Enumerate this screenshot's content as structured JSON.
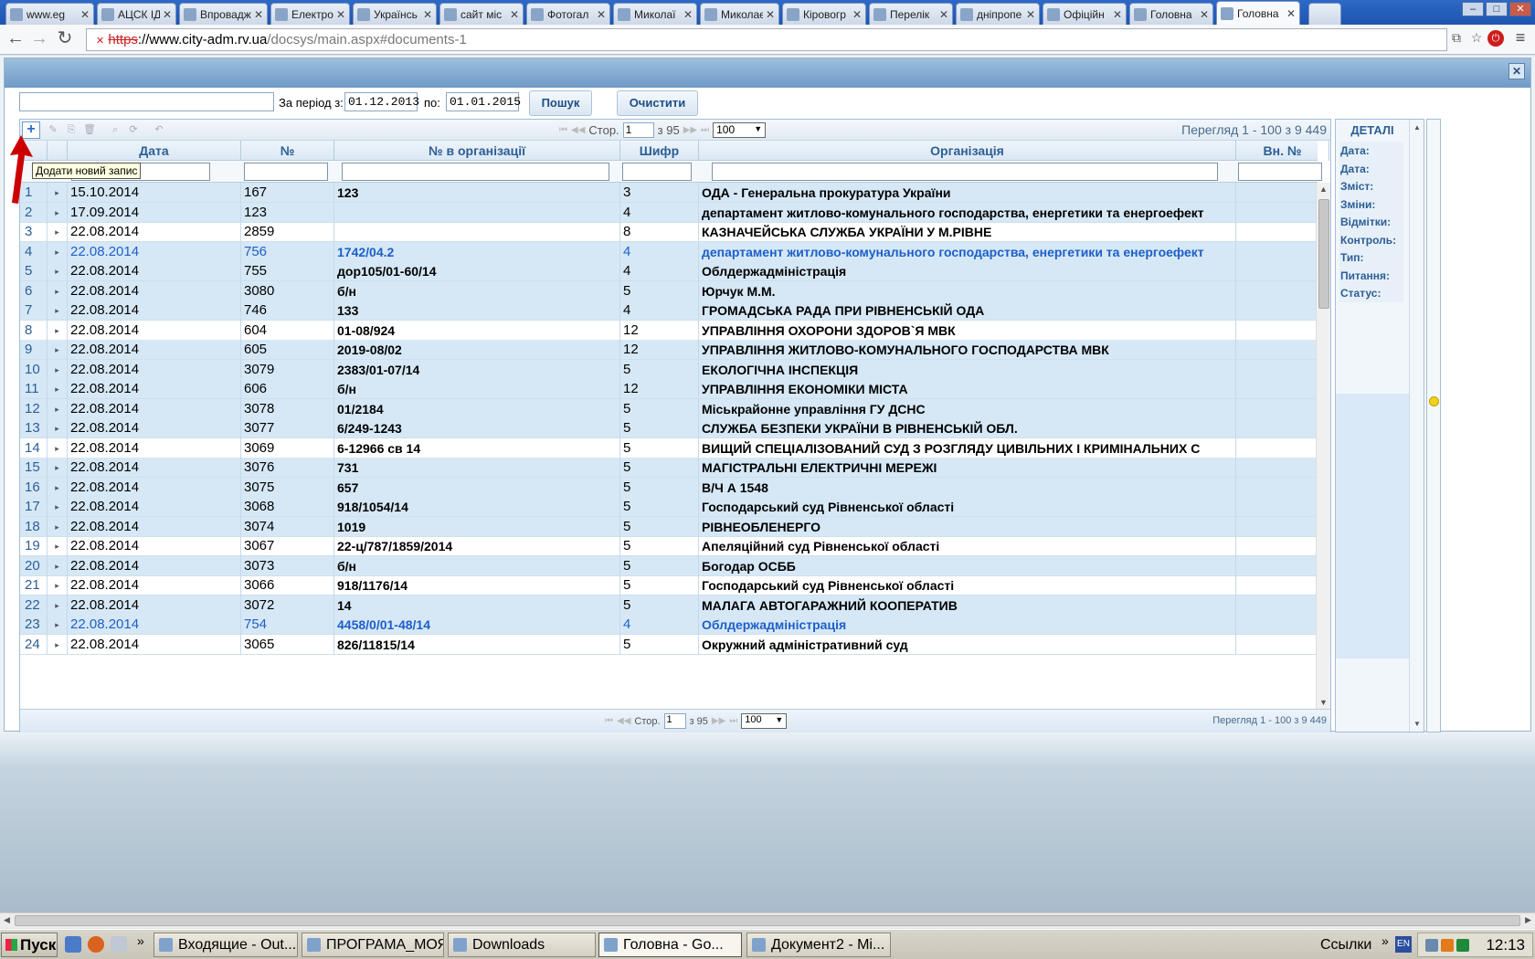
{
  "browser": {
    "tabs": [
      {
        "label": "www.eg",
        "active": false
      },
      {
        "label": "АЦСК ІД",
        "active": false
      },
      {
        "label": "Впровадж",
        "active": false
      },
      {
        "label": "Електро",
        "active": false
      },
      {
        "label": "Українсь",
        "active": false
      },
      {
        "label": "сайт міс",
        "active": false
      },
      {
        "label": "Фотогал",
        "active": false
      },
      {
        "label": "Миколаї",
        "active": false
      },
      {
        "label": "Миколає",
        "active": false
      },
      {
        "label": "Кіровогр",
        "active": false
      },
      {
        "label": "Перелік",
        "active": false
      },
      {
        "label": "дніпропе",
        "active": false
      },
      {
        "label": "Офіційн",
        "active": false
      },
      {
        "label": "Головна",
        "active": false
      },
      {
        "label": "Головна",
        "active": true
      }
    ],
    "url_scheme": "https",
    "url_host": "://www.city-adm.rv.ua",
    "url_path": "/docsys/main.aspx#documents-1"
  },
  "filters": {
    "period_label": "За період з:",
    "date_from": "01.12.2013",
    "to_label": "по:",
    "date_to": "01.01.2015",
    "search_button": "Пошук",
    "clear_button": "Очистити"
  },
  "pager": {
    "page_label": "Стор.",
    "page": "1",
    "of_label": "з 95",
    "page_size": "100",
    "view_text": "Перегляд 1 - 100 з 9 449"
  },
  "tooltip": "Додати новий запис",
  "columns": {
    "date": "Дата",
    "no": "№",
    "org_no": "№ в організації",
    "cipher": "Шифр",
    "organization": "Організація",
    "vn_no": "Вн. №"
  },
  "rows": [
    {
      "n": "1",
      "date": "15.10.2014",
      "no": "167",
      "org_no": "123",
      "cipher": "3",
      "org": "ОДА - Генеральна прокуратура України",
      "blue": false
    },
    {
      "n": "2",
      "date": "17.09.2014",
      "no": "123",
      "org_no": "",
      "cipher": "4",
      "org": "департамент житлово-комунального господарства, енергетики та енергоефект",
      "blue": false
    },
    {
      "n": "3",
      "date": "22.08.2014",
      "no": "2859",
      "org_no": "",
      "cipher": "8",
      "org": "КАЗНАЧЕЙСЬКА СЛУЖБА УКРАЇНИ У М.РІВНЕ",
      "blue": false
    },
    {
      "n": "4",
      "date": "22.08.2014",
      "no": "756",
      "org_no": "1742/04.2",
      "cipher": "4",
      "org": "департамент житлово-комунального господарства, енергетики та енергоефект",
      "blue": true
    },
    {
      "n": "5",
      "date": "22.08.2014",
      "no": "755",
      "org_no": "дор105/01-60/14",
      "cipher": "4",
      "org": "Облдержадміністрація",
      "blue": false
    },
    {
      "n": "6",
      "date": "22.08.2014",
      "no": "3080",
      "org_no": "б/н",
      "cipher": "5",
      "org": "Юрчук М.М.",
      "blue": false
    },
    {
      "n": "7",
      "date": "22.08.2014",
      "no": "746",
      "org_no": "133",
      "cipher": "4",
      "org": "ГРОМАДСЬКА РАДА ПРИ РІВНЕНСЬКІЙ ОДА",
      "blue": false
    },
    {
      "n": "8",
      "date": "22.08.2014",
      "no": "604",
      "org_no": "01-08/924",
      "cipher": "12",
      "org": "УПРАВЛІННЯ ОХОРОНИ ЗДОРОВ`Я МВК",
      "blue": false
    },
    {
      "n": "9",
      "date": "22.08.2014",
      "no": "605",
      "org_no": "2019-08/02",
      "cipher": "12",
      "org": "УПРАВЛІННЯ ЖИТЛОВО-КОМУНАЛЬНОГО ГОСПОДАРСТВА МВК",
      "blue": false
    },
    {
      "n": "10",
      "date": "22.08.2014",
      "no": "3079",
      "org_no": "2383/01-07/14",
      "cipher": "5",
      "org": "ЕКОЛОГІЧНА ІНСПЕКЦІЯ",
      "blue": false
    },
    {
      "n": "11",
      "date": "22.08.2014",
      "no": "606",
      "org_no": "б/н",
      "cipher": "12",
      "org": "УПРАВЛІННЯ ЕКОНОМІКИ МІСТА",
      "blue": false
    },
    {
      "n": "12",
      "date": "22.08.2014",
      "no": "3078",
      "org_no": "01/2184",
      "cipher": "5",
      "org": "Міськрайонне управління  ГУ ДСНС",
      "blue": false
    },
    {
      "n": "13",
      "date": "22.08.2014",
      "no": "3077",
      "org_no": "6/249-1243",
      "cipher": "5",
      "org": "СЛУЖБА БЕЗПЕКИ УКРАЇНИ В РІВНЕНСЬКІЙ ОБЛ.",
      "blue": false
    },
    {
      "n": "14",
      "date": "22.08.2014",
      "no": "3069",
      "org_no": "6-12966 св 14",
      "cipher": "5",
      "org": "ВИЩИЙ СПЕЦІАЛІЗОВАНИЙ СУД З РОЗГЛЯДУ ЦИВІЛЬНИХ І КРИМІНАЛЬНИХ С",
      "blue": false
    },
    {
      "n": "15",
      "date": "22.08.2014",
      "no": "3076",
      "org_no": "731",
      "cipher": "5",
      "org": "МАГІСТРАЛЬНІ ЕЛЕКТРИЧНІ МЕРЕЖІ",
      "blue": false
    },
    {
      "n": "16",
      "date": "22.08.2014",
      "no": "3075",
      "org_no": "657",
      "cipher": "5",
      "org": "В/Ч А 1548",
      "blue": false
    },
    {
      "n": "17",
      "date": "22.08.2014",
      "no": "3068",
      "org_no": "918/1054/14",
      "cipher": "5",
      "org": "Господарський суд Рівненської області",
      "blue": false
    },
    {
      "n": "18",
      "date": "22.08.2014",
      "no": "3074",
      "org_no": "1019",
      "cipher": "5",
      "org": "РІВНЕОБЛЕНЕРГО",
      "blue": false
    },
    {
      "n": "19",
      "date": "22.08.2014",
      "no": "3067",
      "org_no": "22-ц/787/1859/2014",
      "cipher": "5",
      "org": "Апеляційний суд Рівненської області",
      "blue": false
    },
    {
      "n": "20",
      "date": "22.08.2014",
      "no": "3073",
      "org_no": "б/н",
      "cipher": "5",
      "org": "Богодар ОСББ",
      "blue": false
    },
    {
      "n": "21",
      "date": "22.08.2014",
      "no": "3066",
      "org_no": "918/1176/14",
      "cipher": "5",
      "org": "Господарський суд Рівненської області",
      "blue": false
    },
    {
      "n": "22",
      "date": "22.08.2014",
      "no": "3072",
      "org_no": "14",
      "cipher": "5",
      "org": "МАЛАГА АВТОГАРАЖНИЙ КООПЕРАТИВ",
      "blue": false
    },
    {
      "n": "23",
      "date": "22.08.2014",
      "no": "754",
      "org_no": "4458/0/01-48/14",
      "cipher": "4",
      "org": "Облдержадміністрація",
      "blue": true
    },
    {
      "n": "24",
      "date": "22.08.2014",
      "no": "3065",
      "org_no": "826/11815/14",
      "cipher": "5",
      "org": "Окружний адміністративний суд",
      "blue": false
    }
  ],
  "details": {
    "title": "ДЕТАЛІ",
    "fields": [
      "Дата:",
      "Дата:",
      "Зміст:",
      "Зміни:",
      "Відмітки:",
      "Контроль:",
      "Тип:",
      "Питання:",
      "Статус:"
    ]
  },
  "taskbar": {
    "start": "Пуск",
    "tasks": [
      {
        "label": "Входящие - Out...",
        "active": false
      },
      {
        "label": "ПРОГРАМА_МОЯ",
        "active": false
      },
      {
        "label": "Downloads",
        "active": false
      },
      {
        "label": "Головна - Go...",
        "active": true
      },
      {
        "label": "Документ2 - Mi...",
        "active": false
      }
    ],
    "links": "Ссылки",
    "lang": "EN",
    "clock": "12:13"
  }
}
